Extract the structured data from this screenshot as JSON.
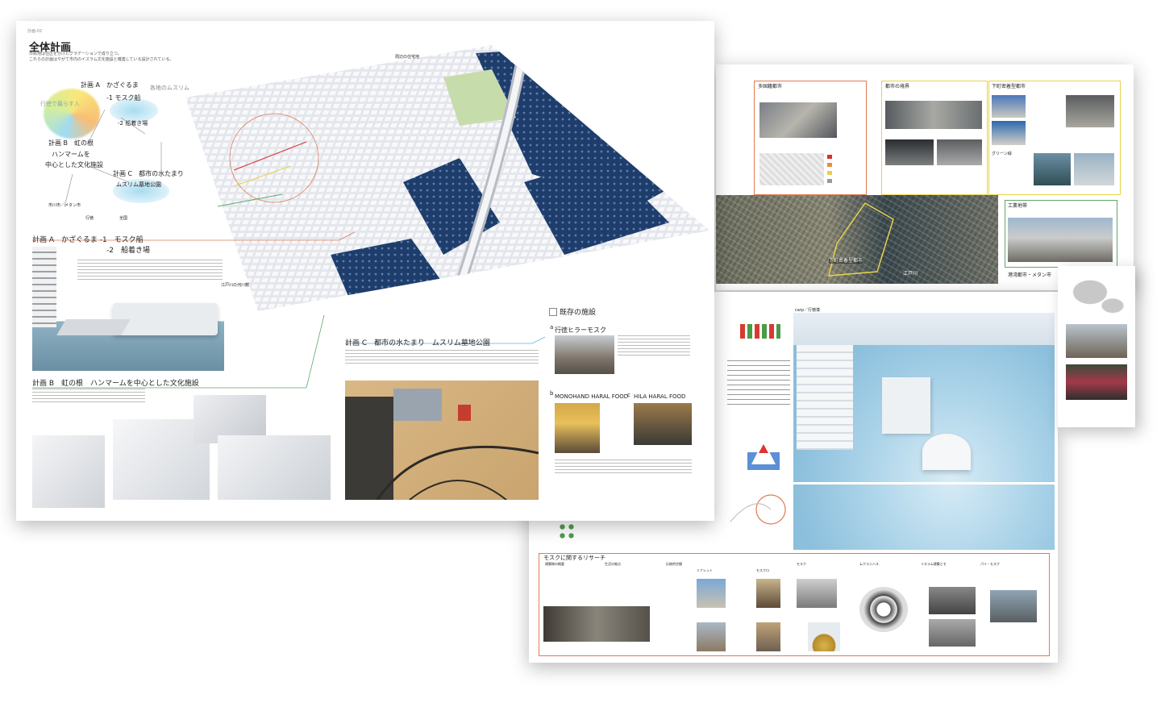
{
  "sheet_back": {
    "sec_tabuka": "多国籍都市",
    "sec_toshi_kyokai": "都市の境界",
    "sec_shitamachi": "下町密着型都市",
    "sec_kogyo": "工業地帯",
    "sec_koro": "港湾都市・メタン市",
    "label_boundary": "下町密着型都市",
    "label_edogawa": "江戸川",
    "label_green": "グリーン緑",
    "label_port": "工場の境",
    "label_kachi": "下町"
  },
  "sheet_mid": {
    "title_model": "carp／行徳湊",
    "research_title": "モスクに関するリサーチ",
    "research_col1": "建築物の概要",
    "research_col2": "生活の拠点",
    "research_col3": "伝統的空間",
    "research_col4": "ミナレット",
    "research_col5": "モスクロ",
    "research_col6": "モスク",
    "research_col7": "ムクラニハス",
    "research_col8": "イスラム建築とモ",
    "research_col9": "パリ・モスク"
  },
  "sheet_front": {
    "page_label": "計画-02",
    "title": "全体計画",
    "intro": "市街地は住区を分けたグラデーションで成り立つ。",
    "intro2": "これらの計画はやがて市内のイスラム文化施設と確連している設計されている。",
    "diagram": {
      "plan_a": "計画 A　かざぐるま",
      "plan_a_1": "-1 モスク船",
      "plan_a_2": "-2 船着き場",
      "local_muslim": "各地のムスリム",
      "visitors": "行徳で暮らす人",
      "plan_b": "計画 B　虹の根",
      "plan_b_sub1": "ハンマームを",
      "plan_b_sub2": "中心とした文化施設",
      "plan_c": "計画 C　都市の水たまり",
      "plan_c_sub": "ムスリム墓地公園",
      "bottom_left": "市川市／メタン市",
      "bottom_mid": "行徳",
      "bottom_right": "全国"
    },
    "section_a": {
      "title": "計画 A　かざぐるま -1　モスク船",
      "subtitle": "-2　船着き場"
    },
    "section_b": {
      "title": "計画 B　虹の根　ハンマームを中心とした文化施設"
    },
    "section_c": {
      "title": "計画 C　都市の水たまり　ムスリム墓地公園"
    },
    "existing": {
      "title": "既存の施設",
      "a_label": "a",
      "a_name": "行徳ヒラーモスク",
      "b_label": "b",
      "b_name": "MONOHAND HARAL FOOD",
      "c_label": "c",
      "c_name": "HILA HARAL FOOD"
    },
    "map_label_top": "周辺の住宅地",
    "map_label_left": "江戸川の河川敷"
  },
  "colors": {
    "orange_line": "#e07b52",
    "yellow_line": "#e8d24a",
    "green_line": "#5ea86a",
    "blue_city": "#1f3d6b",
    "map_bg": "#e4e6ec",
    "sand": "#d9b885"
  }
}
